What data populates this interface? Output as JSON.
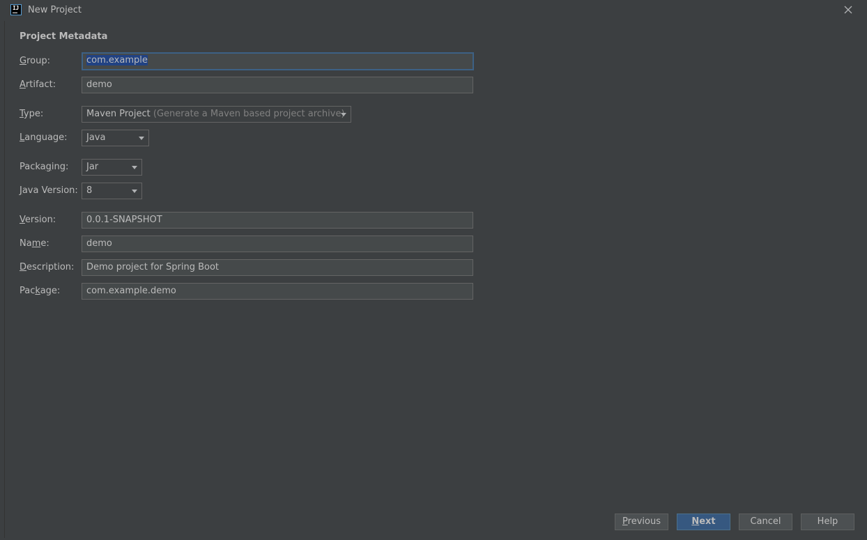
{
  "window": {
    "title": "New Project",
    "app_icon_text": "IJ",
    "icons": {
      "app": "intellij-logo-icon",
      "close": "close-icon",
      "dropdown": "chevron-down-icon"
    }
  },
  "section": {
    "title": "Project Metadata"
  },
  "fields": {
    "group": {
      "label_prefix": "",
      "label_mnemonic": "G",
      "label_rest": "roup:",
      "value": "com.example"
    },
    "artifact": {
      "label_prefix": "",
      "label_mnemonic": "A",
      "label_rest": "rtifact:",
      "value": "demo"
    },
    "type": {
      "label_prefix": "",
      "label_mnemonic": "T",
      "label_rest": "ype:",
      "value": "Maven Project",
      "hint": "(Generate a Maven based project archive)"
    },
    "language": {
      "label_prefix": "",
      "label_mnemonic": "L",
      "label_rest": "anguage:",
      "value": "Java"
    },
    "packaging": {
      "label_prefix": "Packa",
      "label_mnemonic": "g",
      "label_rest": "ing:",
      "value": "Jar"
    },
    "java_version": {
      "label_prefix": "",
      "label_mnemonic": "J",
      "label_rest": "ava Version:",
      "value": "8"
    },
    "version": {
      "label_prefix": "",
      "label_mnemonic": "V",
      "label_rest": "ersion:",
      "value": "0.0.1-SNAPSHOT"
    },
    "name": {
      "label_prefix": "Na",
      "label_mnemonic": "m",
      "label_rest": "e:",
      "value": "demo"
    },
    "description": {
      "label_prefix": "",
      "label_mnemonic": "D",
      "label_rest": "escription:",
      "value": "Demo project for Spring Boot"
    },
    "package": {
      "label_prefix": "Pac",
      "label_mnemonic": "k",
      "label_rest": "age:",
      "value": "com.example.demo"
    }
  },
  "buttons": {
    "previous": {
      "mnemonic": "P",
      "rest": "revious"
    },
    "next": {
      "mnemonic": "N",
      "rest": "ext"
    },
    "cancel": {
      "label": "Cancel"
    },
    "help": {
      "label": "Help"
    }
  },
  "colors": {
    "background": "#3c3f41",
    "field_bg": "#45494a",
    "field_border": "#646464",
    "focus_border": "#3d6185",
    "selection": "#214283",
    "primary_button": "#365880",
    "text": "#bbbbbb",
    "hint_text": "#808080"
  }
}
